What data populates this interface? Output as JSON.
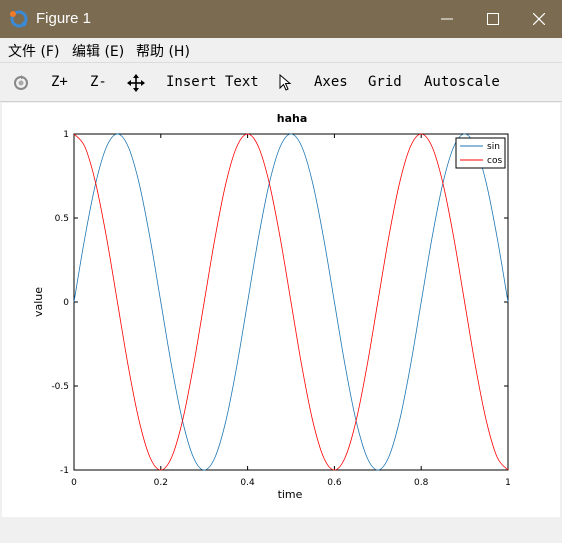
{
  "window": {
    "title": "Figure 1"
  },
  "menu": {
    "items": [
      "文件 (F)",
      "编辑 (E)",
      "帮助 (H)"
    ]
  },
  "toolbar": {
    "zoom_in": "Z+",
    "zoom_out": "Z-",
    "insert_text": "Insert Text",
    "axes": "Axes",
    "grid": "Grid",
    "autoscale": "Autoscale"
  },
  "colors": {
    "titlebar": "#7b6b50",
    "sin": "#1f77b4",
    "cos": "#ff0000"
  },
  "chart_data": {
    "type": "line",
    "title": "haha",
    "xlabel": "time",
    "ylabel": "value",
    "xlim": [
      0,
      1
    ],
    "ylim": [
      -1,
      1
    ],
    "xticks": [
      0,
      0.2,
      0.4,
      0.6,
      0.8,
      1
    ],
    "xtick_labels": [
      "0",
      "0.2",
      "0.4",
      "0.6",
      "0.8",
      "1"
    ],
    "yticks": [
      -1,
      -0.5,
      0,
      0.5,
      1
    ],
    "ytick_labels": [
      "-1",
      "-0.5",
      "0",
      "0.5",
      "1"
    ],
    "grid": false,
    "legend": "top-right",
    "x": [
      0,
      0.025,
      0.05,
      0.075,
      0.1,
      0.125,
      0.15,
      0.175,
      0.2,
      0.225,
      0.25,
      0.275,
      0.3,
      0.325,
      0.35,
      0.375,
      0.4,
      0.425,
      0.45,
      0.475,
      0.5,
      0.525,
      0.55,
      0.575,
      0.6,
      0.625,
      0.65,
      0.675,
      0.7,
      0.725,
      0.75,
      0.775,
      0.8,
      0.825,
      0.85,
      0.875,
      0.9,
      0.925,
      0.95,
      0.975,
      1
    ],
    "series": [
      {
        "name": "sin",
        "color": "#1f77b4",
        "values": [
          0,
          0.383,
          0.707,
          0.924,
          1,
          0.924,
          0.707,
          0.383,
          0,
          -0.383,
          -0.707,
          -0.924,
          -1,
          -0.924,
          -0.707,
          -0.383,
          0,
          0.383,
          0.707,
          0.924,
          1,
          0.924,
          0.707,
          0.383,
          0,
          -0.383,
          -0.707,
          -0.924,
          -1,
          -0.924,
          -0.707,
          -0.383,
          0,
          0.383,
          0.707,
          0.924,
          1,
          0.924,
          0.707,
          0.383,
          0
        ]
      },
      {
        "name": "cos",
        "color": "#ff0000",
        "values": [
          1,
          0.924,
          0.707,
          0.383,
          0,
          -0.383,
          -0.707,
          -0.924,
          -1,
          -0.924,
          -0.707,
          -0.383,
          0,
          0.383,
          0.707,
          0.924,
          1,
          0.924,
          0.707,
          0.383,
          0,
          -0.383,
          -0.707,
          -0.924,
          -1,
          -0.924,
          -0.707,
          -0.383,
          0,
          0.383,
          0.707,
          0.924,
          1,
          0.924,
          0.707,
          0.383,
          0,
          -0.383,
          -0.707,
          -0.924,
          -1
        ]
      }
    ]
  }
}
